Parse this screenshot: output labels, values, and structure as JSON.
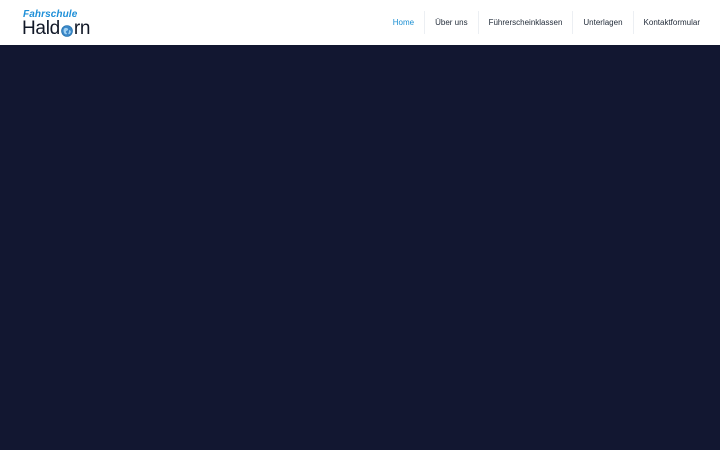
{
  "brand": {
    "top": "Fahrschule",
    "bottom_start": "Hald",
    "bottom_end": "rn",
    "globe_icon": "globe-icon",
    "colors": {
      "top": "#1d8fd8",
      "bottom": "#111827"
    }
  },
  "nav": {
    "items": [
      {
        "label": "Home",
        "active": true
      },
      {
        "label": "Über uns",
        "active": false
      },
      {
        "label": "Führerscheinklassen",
        "active": false
      },
      {
        "label": "Unterlagen",
        "active": false
      },
      {
        "label": "Kontaktformular",
        "active": false
      }
    ],
    "active_color": "#1a8fd3",
    "text_color": "#1f2937"
  },
  "hero": {
    "background_color": "#121731"
  }
}
